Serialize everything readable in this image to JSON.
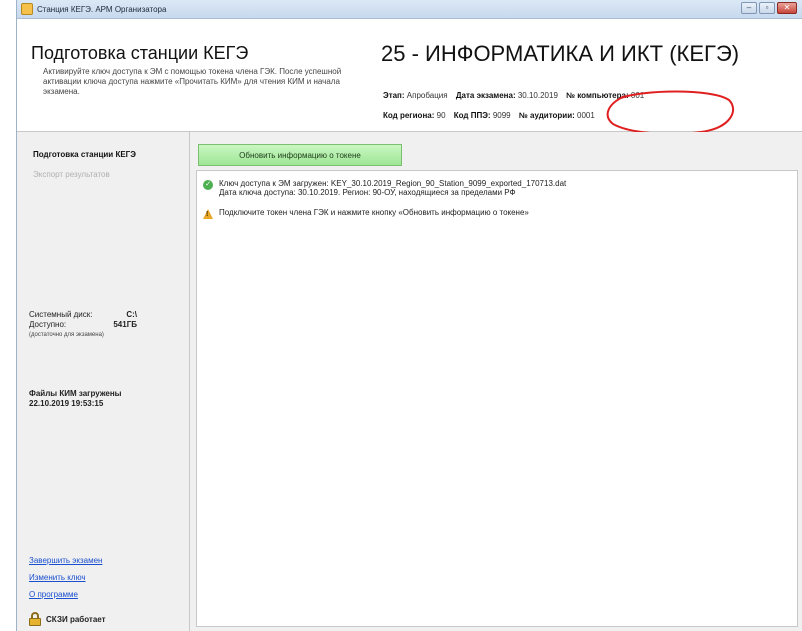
{
  "window": {
    "title": "Станция КЕГЭ. АРМ Организатора"
  },
  "header": {
    "title": "Подготовка станции КЕГЭ",
    "description": "Активируйте ключ доступа к ЭМ с помощью токена члена ГЭК. После успешной активации ключа доступа нажмите «Прочитать КИМ» для чтения КИМ и начала экзамена.",
    "exam_title": "25 - ИНФОРМАТИКА И ИКТ (КЕГЭ)",
    "stage_label": "Этап:",
    "stage_value": "Апробация",
    "exam_date_label": "Дата экзамена:",
    "exam_date_value": "30.10.2019",
    "computer_no_label": "№ компьютера:",
    "computer_no_value": "001",
    "region_label": "Код региона:",
    "region_value": "90",
    "ppe_label": "Код ППЭ:",
    "ppe_value": "9099",
    "auditorium_label": "№ аудитории:",
    "auditorium_value": "0001"
  },
  "sidebar": {
    "items": [
      {
        "label": "Подготовка станции КЕГЭ",
        "state": "active"
      },
      {
        "label": "Экспорт результатов",
        "state": "disabled"
      }
    ],
    "disk": {
      "system_label": "Системный диск:",
      "system_value": "C:\\",
      "free_label": "Доступно:",
      "free_value": "541ГБ",
      "note": "(достаточно для экзамена)"
    },
    "files": {
      "status": "Файлы КИМ загружены",
      "timestamp": "22.10.2019 19:53:15"
    },
    "links": [
      "Завершить экзамен",
      "Изменить ключ",
      "О программе"
    ],
    "skzi_status": "СКЗИ работает"
  },
  "content": {
    "refresh_button": "Обновить информацию о токене",
    "messages": [
      {
        "type": "success",
        "icon": "check-circle-icon",
        "line1": "Ключ доступа к ЭМ загружен: KEY_30.10.2019_Region_90_Station_9099_exported_170713.dat",
        "line2": "Дата ключа доступа: 30.10.2019. Регион: 90-ОУ, находящиеся за пределами РФ"
      },
      {
        "type": "warning",
        "icon": "warning-icon",
        "line1": "Подключите токен члена ГЭК и нажмите кнопку «Обновить информацию о токене»"
      }
    ]
  },
  "colors": {
    "accent_green": "#9ee694",
    "link": "#1a4fd0",
    "annotation_red": "#e02020"
  }
}
